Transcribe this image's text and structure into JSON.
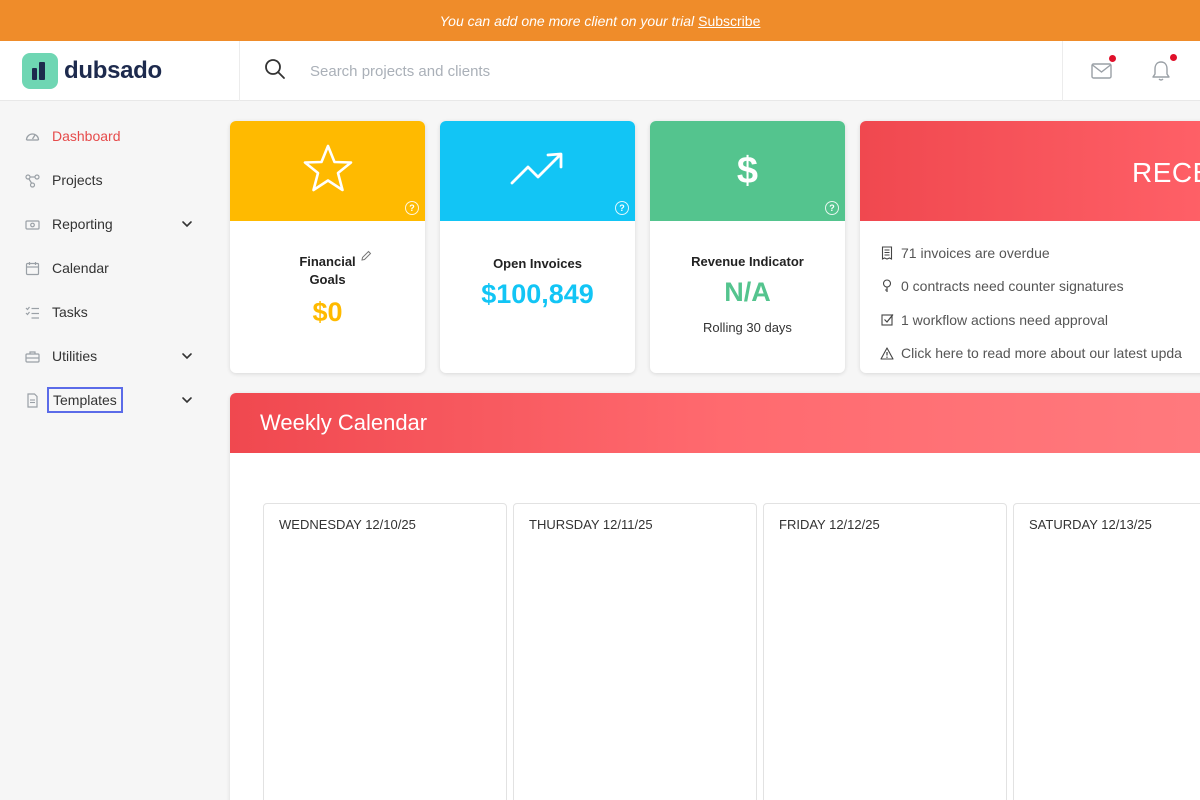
{
  "banner": {
    "text": "You can add one more client on your trial",
    "link": "Subscribe",
    "color": "#ef8c2a"
  },
  "logo": {
    "text": "dubsado"
  },
  "search": {
    "placeholder": "Search projects and clients",
    "value": ""
  },
  "header_icons": [
    "mail-icon",
    "bell-icon"
  ],
  "sidebar": {
    "items": [
      {
        "label": "Dashboard",
        "icon": "dashboard-icon",
        "active": true
      },
      {
        "label": "Projects",
        "icon": "projects-icon"
      },
      {
        "label": "Reporting",
        "icon": "reporting-icon",
        "expandable": true
      },
      {
        "label": "Calendar",
        "icon": "calendar-icon"
      },
      {
        "label": "Tasks",
        "icon": "tasks-icon"
      },
      {
        "label": "Utilities",
        "icon": "utilities-icon",
        "expandable": true
      },
      {
        "label": "Templates",
        "icon": "templates-icon",
        "expandable": true,
        "focused": true
      }
    ]
  },
  "cards": {
    "financial": {
      "title_line1": "Financial",
      "title_line2": "Goals",
      "value": "$0",
      "color": "#ffba00",
      "icon": "star-icon"
    },
    "invoices": {
      "title": "Open Invoices",
      "value": "$100,849",
      "color": "#12c5f5",
      "icon": "trending-up-icon"
    },
    "revenue": {
      "title": "Revenue Indicator",
      "value": "N/A",
      "note": "Rolling 30 days",
      "color": "#54c48e",
      "icon": "dollar-icon"
    }
  },
  "recent": {
    "title": "RECE",
    "items": [
      {
        "text": "71 invoices are overdue",
        "icon": "invoice-icon"
      },
      {
        "text": "0 contracts need counter signatures",
        "icon": "award-icon"
      },
      {
        "text": "1 workflow actions need approval",
        "icon": "checkbox-icon"
      },
      {
        "text": "Click here to read more about our latest upda",
        "icon": "warning-icon"
      }
    ]
  },
  "calendar": {
    "title": "Weekly Calendar",
    "days": [
      "WEDNESDAY 12/10/25",
      "THURSDAY 12/11/25",
      "FRIDAY 12/12/25",
      "SATURDAY 12/13/25"
    ]
  }
}
